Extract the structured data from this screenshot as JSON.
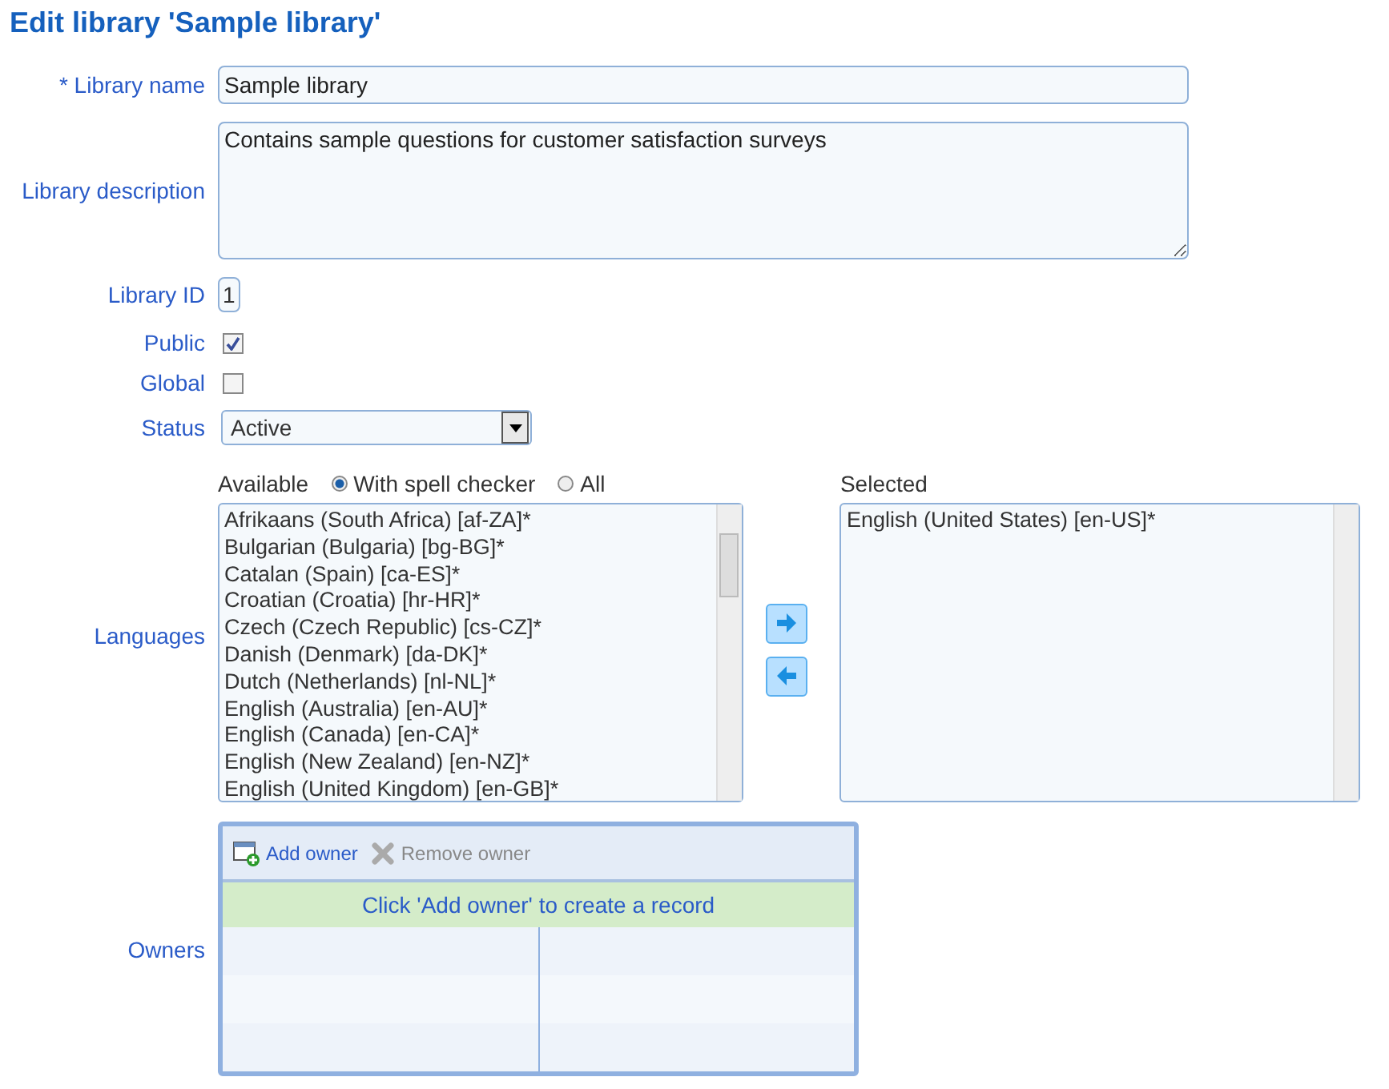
{
  "title": "Edit library 'Sample library'",
  "fields": {
    "name": {
      "label": "* Library name",
      "value": "Sample library"
    },
    "description": {
      "label": "Library description",
      "value": "Contains sample questions for customer satisfaction surveys"
    },
    "id": {
      "label": "Library ID",
      "value": "1"
    },
    "public": {
      "label": "Public",
      "checked": true
    },
    "global": {
      "label": "Global",
      "checked": false
    },
    "status": {
      "label": "Status",
      "value": "Active"
    }
  },
  "languages": {
    "label": "Languages",
    "available_label": "Available",
    "filters": [
      {
        "label": "With spell checker",
        "selected": true
      },
      {
        "label": "All",
        "selected": false
      }
    ],
    "selected_label": "Selected",
    "available": [
      "Afrikaans (South Africa) [af-ZA]*",
      "Bulgarian (Bulgaria) [bg-BG]*",
      "Catalan (Spain) [ca-ES]*",
      "Croatian (Croatia) [hr-HR]*",
      "Czech (Czech Republic) [cs-CZ]*",
      "Danish (Denmark) [da-DK]*",
      "Dutch (Netherlands) [nl-NL]*",
      "English (Australia) [en-AU]*",
      "English (Canada) [en-CA]*",
      "English (New Zealand) [en-NZ]*",
      "English (United Kingdom) [en-GB]*"
    ],
    "selected": [
      "English (United States) [en-US]*"
    ]
  },
  "owners": {
    "label": "Owners",
    "toolbar": [
      {
        "label": "Add owner",
        "kind": "add",
        "disabled": false
      },
      {
        "label": "Remove owner",
        "kind": "remove",
        "disabled": true
      }
    ],
    "empty_message": "Click 'Add owner' to create a record"
  }
}
